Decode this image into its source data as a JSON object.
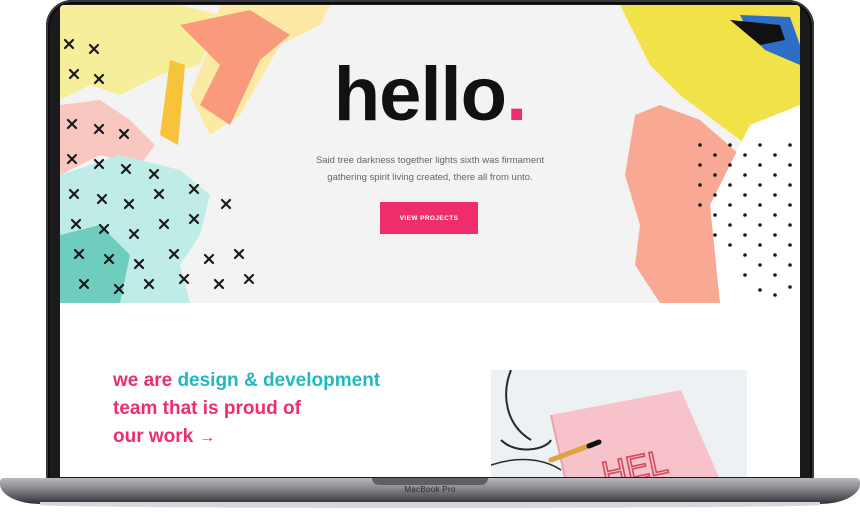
{
  "hero": {
    "title": "hello",
    "title_dot": ".",
    "subtitle_line1": "Said tree darkness together lights sixth was firmament",
    "subtitle_line2": "gathering spirit living created, there all from unto.",
    "button_label": "VIEW PROJECTS"
  },
  "intro": {
    "text_part1": "we are ",
    "text_highlight": "design & development",
    "text_part2": "team that is proud of",
    "text_part3": "our work",
    "arrow": "→",
    "photo_text": "HEL"
  },
  "device": {
    "label": "MacBook Pro"
  },
  "colors": {
    "accent_pink": "#ef2d6a",
    "accent_teal": "#1fb8c3",
    "hero_bg": "#f3f3f3",
    "text_dark": "#111111"
  },
  "icons": {
    "arrow": "arrow-right-icon"
  }
}
